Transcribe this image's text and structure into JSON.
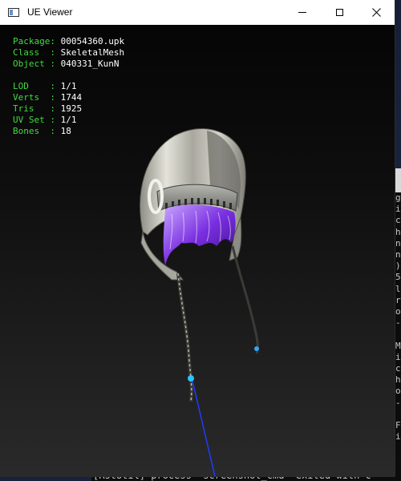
{
  "window": {
    "title": "UE Viewer",
    "minimize_label": "",
    "maximize_label": "",
    "close_label": ""
  },
  "info": {
    "package_label": "Package",
    "package_value": "00054360.upk",
    "class_label": "Class  ",
    "class_value": "SkeletalMesh",
    "object_label": "Object ",
    "object_value": "040331_KunN",
    "lod_label": "LOD    ",
    "lod_value": "1/1",
    "verts_label": "Verts  ",
    "verts_value": "1744",
    "tris_label": "Tris   ",
    "tris_value": "1925",
    "uvset_label": "UV Set ",
    "uvset_value": "1/1",
    "bones_label": "Bones  ",
    "bones_value": "18"
  },
  "console": {
    "side_lines": [
      "g",
      "i",
      "c",
      "h",
      "n",
      "n",
      ")",
      "5",
      "l",
      "r",
      "o",
      "-",
      "",
      "M",
      "i",
      "c",
      "h",
      "o",
      "-",
      "",
      "F",
      "i"
    ],
    "bottom_text": "[RstUtil] process \"screenshot_cmd\" exited with c",
    "left_edge_char": "M"
  },
  "colors": {
    "label_green": "#3fdc3f",
    "value_white": "#ffffff",
    "hair_purple": "#8a2be2",
    "bone_blue": "#1f3cff"
  }
}
